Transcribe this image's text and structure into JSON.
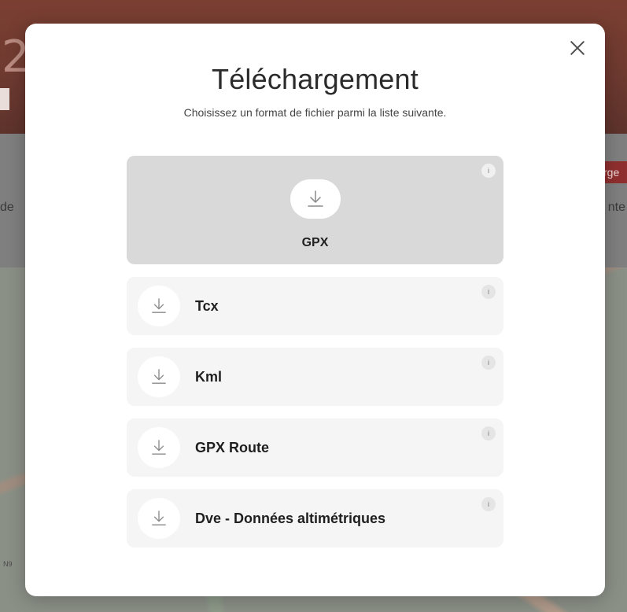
{
  "background": {
    "hero_fragment": "2",
    "left_text": "de",
    "right_text": "nte",
    "right_badge": "rge",
    "map_label": "N9"
  },
  "modal": {
    "title": "Téléchargement",
    "subtitle": "Choisissez un format de fichier parmi la liste suivante.",
    "close_icon": "close-icon",
    "info_badge_glyph": "i",
    "formats": [
      {
        "label": "GPX",
        "selected": true
      },
      {
        "label": "Tcx",
        "selected": false
      },
      {
        "label": "Kml",
        "selected": false
      },
      {
        "label": "GPX Route",
        "selected": false
      },
      {
        "label": "Dve - Données altimétriques",
        "selected": false
      }
    ]
  },
  "colors": {
    "selected_bg": "#d9d9d9",
    "item_bg": "#f5f5f5",
    "icon_stroke": "#8a8a8a"
  }
}
